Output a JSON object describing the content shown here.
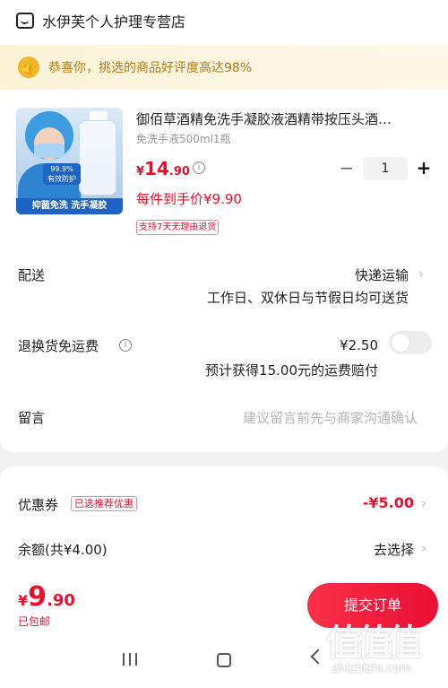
{
  "store": {
    "name": "水伊芙个人护理专营店",
    "icon": "shop-icon"
  },
  "banner": {
    "text": "恭喜你，挑选的商品好评度高达98%",
    "icon": "thumbs-up-icon"
  },
  "product": {
    "title": "御佰草酒精免洗手凝胶液酒精带按压头酒…",
    "spec": "免洗手液500ml1瓶",
    "price_currency": "¥",
    "price_int": "14",
    "price_dec": ".90",
    "deal_price": "每件到手价¥9.90",
    "return_tag": "支持7天无理由退货",
    "image": {
      "badge_line1": "99.9%",
      "badge_line2": "有效防护",
      "strip": "抑菌免洗 洗手凝胶"
    },
    "quantity": "1",
    "minus_label": "−",
    "plus_label": "+"
  },
  "delivery": {
    "label": "配送",
    "method": "快递运输",
    "detail": "工作日、双休日与节假日均可送货"
  },
  "return_insurance": {
    "label": "退换货免运费",
    "price": "¥2.50",
    "detail": "预计获得15.00元的运费赔付",
    "enabled": false
  },
  "note": {
    "label": "留言",
    "placeholder": "建议留言前先与商家沟通确认"
  },
  "coupon": {
    "label": "优惠券",
    "tag": "已选推荐优惠",
    "value": "-¥5.00"
  },
  "balance": {
    "label": "余额(共¥4.00)",
    "action": "去选择"
  },
  "footer": {
    "total_currency": "¥",
    "total_int": "9",
    "total_dec": ".90",
    "shipping": "已包邮",
    "submit_label": "提交订单"
  },
  "watermark": {
    "site": "zhizhizhi.com"
  },
  "colors": {
    "accent": "#e8112d",
    "banner_text": "#b07a18",
    "banner_bg": "#fdf4d8"
  }
}
